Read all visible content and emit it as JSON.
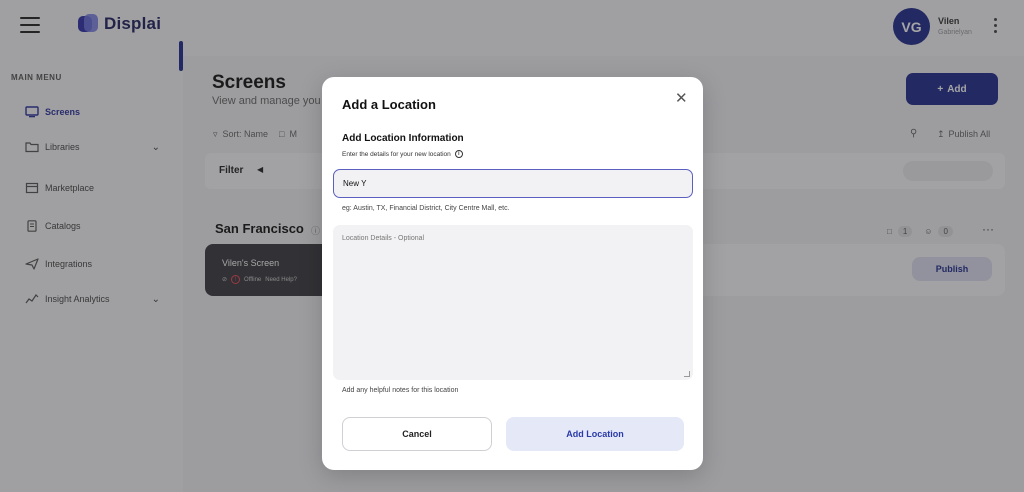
{
  "app": {
    "brand": "Displai",
    "brand_color": "#1f2a8c"
  },
  "user": {
    "initials": "VG",
    "name": "Vilen",
    "subtitle": "Gabrielyan"
  },
  "sidebar": {
    "menu_title": "MAIN MENU",
    "items": [
      {
        "label": "Screens",
        "icon": "monitor-icon",
        "active": true
      },
      {
        "label": "Libraries",
        "icon": "folder-icon",
        "has_chevron": true
      },
      {
        "label": "Marketplace",
        "icon": "store-icon"
      },
      {
        "label": "Catalogs",
        "icon": "catalog-icon"
      },
      {
        "label": "Integrations",
        "icon": "send-icon"
      },
      {
        "label": "Insight Analytics",
        "icon": "analytics-icon",
        "has_chevron": true
      }
    ]
  },
  "page": {
    "title": "Screens",
    "subtitle": "View and manage you",
    "add_label": "Add",
    "toolbar": {
      "sort_label": "Sort: Name",
      "second_label": "M",
      "publish_all_label": "Publish All"
    },
    "filter_label": "Filter",
    "group": {
      "title": "San Francisco",
      "screen_count": "1",
      "user_count": "0"
    },
    "screen": {
      "name": "Vilen's Screen",
      "status": "Offline",
      "help": "Need Help?"
    },
    "publish_label": "Publish"
  },
  "modal": {
    "title": "Add a Location",
    "section_title": "Add Location Information",
    "section_subtitle": "Enter the details for your new location",
    "name_value": "New Y",
    "name_hint": "eg: Austin, TX, Financial District, City Centre Mall, etc.",
    "details_placeholder": "Location Details - Optional",
    "details_hint": "Add any helpful notes for this location",
    "cancel_label": "Cancel",
    "submit_label": "Add Location"
  }
}
